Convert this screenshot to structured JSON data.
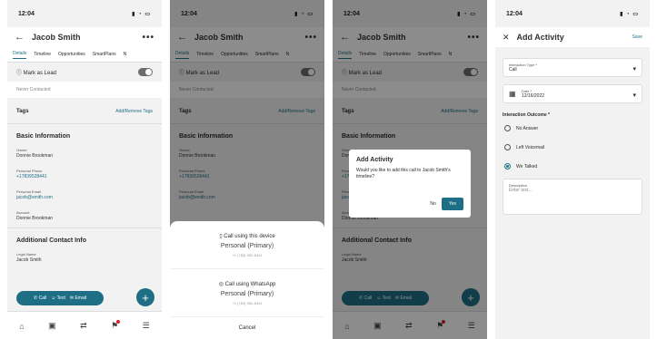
{
  "status": {
    "time": "12:04"
  },
  "contact": {
    "name": "Jacob Smith"
  },
  "tabs": [
    "Details",
    "Timeline",
    "Opportunities",
    "SmartPlans",
    "N"
  ],
  "details": {
    "lead_label": "Mark as Lead",
    "never_contacted": "Never Contacted",
    "tags_label": "Tags",
    "tags_action": "Add/Remove Tags",
    "basic_info": "Basic Information",
    "owner_label": "Owner",
    "owner_value": "Donnie Brookman",
    "phone_label": "Personal Phone",
    "phone_value": "+17839528441",
    "email_label": "Personal Email",
    "email_value": "jacob@smith.com",
    "account_label": "Account",
    "account_value": "Donnie Brookman",
    "additional_info": "Additional Contact Info",
    "legal_label": "Legal Name",
    "legal_value": "Jacob Smith"
  },
  "actions": {
    "call": "Call",
    "text": "Text",
    "email": "Email"
  },
  "sheet": {
    "device_label": "Call using this device",
    "whatsapp_label": "Call using WhatsApp",
    "personal_primary": "Personal (Primary)",
    "number": "+1 (783) 952-8441",
    "cancel": "Cancel"
  },
  "dialog": {
    "title": "Add Activity",
    "text": "Would you like to add this call to Jacob Smith's timeline?",
    "no": "No",
    "yes": "Yes"
  },
  "add_activity": {
    "title": "Add Activity",
    "save": "Save",
    "interaction_type_label": "Interaction Type *",
    "interaction_type_value": "Call",
    "date_label": "Date *",
    "date_value": "12/16/2022",
    "outcome_label": "Interaction Outcome *",
    "outcome_options": [
      "No Answer",
      "Left Voicemail",
      "We Talked"
    ],
    "description_label": "Description",
    "description_placeholder": "Enter text..."
  },
  "colors": {
    "accent": "#1e6f86",
    "background": "#f2f2f2"
  }
}
